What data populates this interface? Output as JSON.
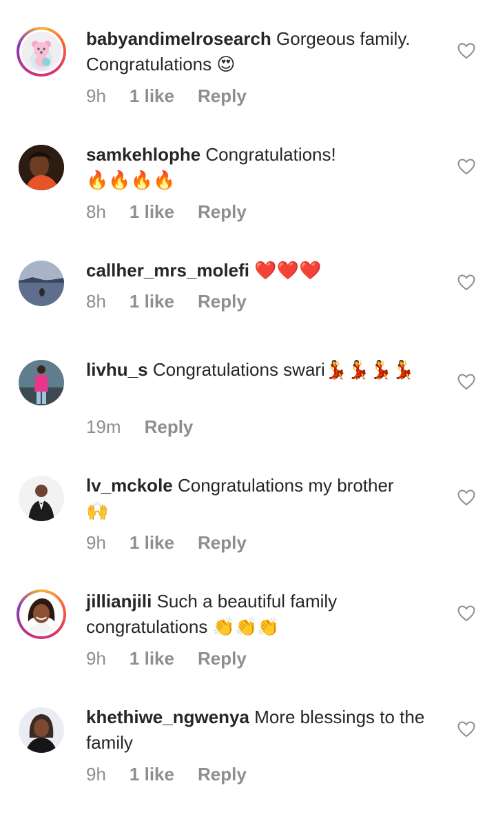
{
  "comments": [
    {
      "username": "babyandimelrosearch",
      "text": "Gorgeous family. Congratulations",
      "emoji": "😍",
      "time": "9h",
      "likes": "1 like",
      "reply": "Reply",
      "avatar": "teddy-bear-avatar",
      "story_ring": true
    },
    {
      "username": "samkehlophe",
      "text": "Congratulations!",
      "emoji": "🔥🔥🔥🔥",
      "time": "8h",
      "likes": "1 like",
      "reply": "Reply",
      "avatar": "person-avatar",
      "story_ring": false
    },
    {
      "username": "callher_mrs_molefi",
      "text": "",
      "emoji": "❤️❤️❤️",
      "time": "8h",
      "likes": "1 like",
      "reply": "Reply",
      "avatar": "lake-avatar",
      "story_ring": false
    },
    {
      "username": "livhu_s",
      "text": "Congratulations swari",
      "emoji": "💃💃💃💃",
      "time": "19m",
      "likes": "",
      "reply": "Reply",
      "avatar": "person-avatar",
      "story_ring": false
    },
    {
      "username": "lv_mckole",
      "text": "Congratulations my brother",
      "emoji": "🙌",
      "time": "9h",
      "likes": "1 like",
      "reply": "Reply",
      "avatar": "man-in-suit-avatar",
      "story_ring": false
    },
    {
      "username": "jillianjili",
      "text": "Such a beautiful family congratulations",
      "emoji": "👏👏👏",
      "time": "9h",
      "likes": "1 like",
      "reply": "Reply",
      "avatar": "woman-avatar",
      "story_ring": true
    },
    {
      "username": "khethiwe_ngwenya",
      "text": "More blessings to the family",
      "emoji": "",
      "time": "9h",
      "likes": "1 like",
      "reply": "Reply",
      "avatar": "woman-avatar",
      "story_ring": false
    }
  ],
  "colors": {
    "text": "#262626",
    "meta": "#8e8e8e",
    "heart_outline": "#8e8e8e"
  }
}
